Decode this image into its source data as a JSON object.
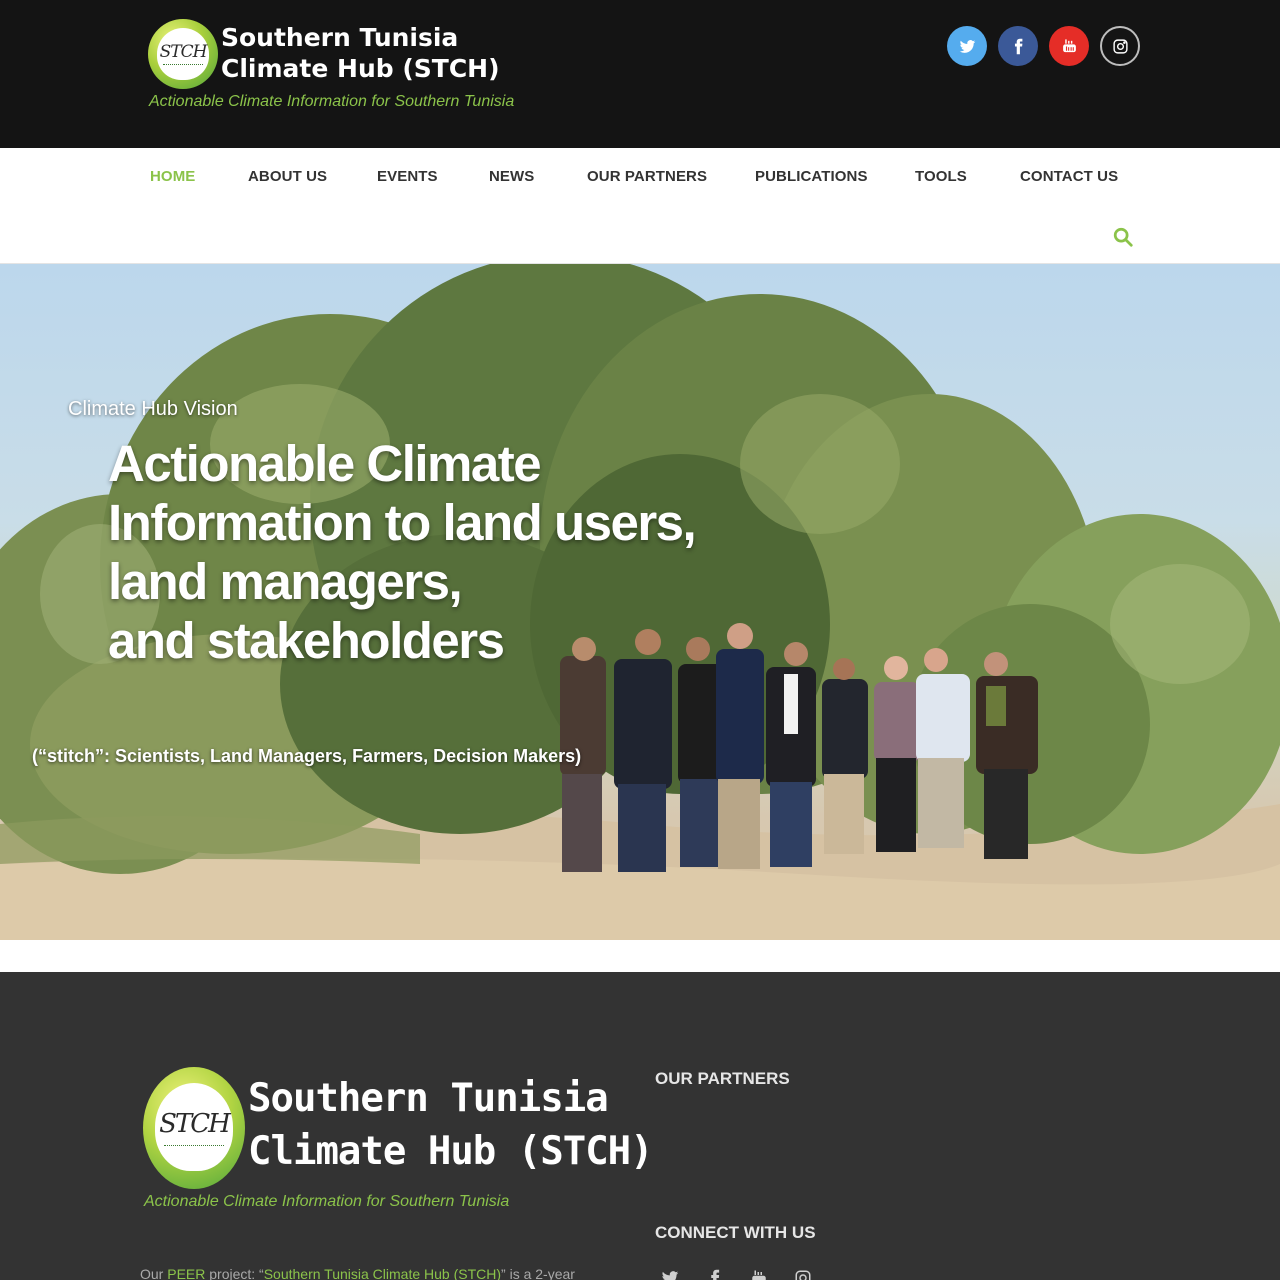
{
  "header": {
    "brand_line1": "Southern Tunisia",
    "brand_line2": "Climate Hub (STCH)",
    "tagline": "Actionable Climate Information for Southern Tunisia",
    "logo_mark": "STCH",
    "social": [
      {
        "name": "twitter",
        "icon": "twitter-icon"
      },
      {
        "name": "facebook",
        "icon": "facebook-icon"
      },
      {
        "name": "youtube",
        "icon": "youtube-icon"
      },
      {
        "name": "instagram",
        "icon": "instagram-icon"
      }
    ]
  },
  "nav": {
    "items": [
      {
        "label": "HOME",
        "active": true
      },
      {
        "label": "ABOUT US"
      },
      {
        "label": "EVENTS"
      },
      {
        "label": "NEWS"
      },
      {
        "label": "OUR PARTNERS"
      },
      {
        "label": "PUBLICATIONS"
      },
      {
        "label": "TOOLS"
      },
      {
        "label": "CONTACT US"
      }
    ],
    "search_icon": "search-icon"
  },
  "hero": {
    "eyebrow": "Climate Hub Vision",
    "headline": [
      "Actionable Climate",
      "Information to land users,",
      "land managers,",
      "and stakeholders"
    ],
    "subtitle": "(“stitch”: Scientists, Land Managers, Farmers, Decision Makers)"
  },
  "footer": {
    "brand_line1": "Southern Tunisia",
    "brand_line2": "Climate Hub (STCH)",
    "tagline": "Actionable Climate Information for Southern Tunisia",
    "partners_heading": "OUR PARTNERS",
    "connect_heading": "CONNECT WITH US",
    "about": {
      "prefix": "Our ",
      "link1": "PEER",
      "middle": " project: “",
      "link2": "Southern Tunisia Climate Hub (STCH)",
      "suffix": "” is a 2-year"
    }
  },
  "colors": {
    "accent": "#8bc34a",
    "topbar": "#141414",
    "footer": "#333333",
    "twitter": "#55acee",
    "facebook": "#3b5998",
    "youtube": "#e52d27"
  }
}
